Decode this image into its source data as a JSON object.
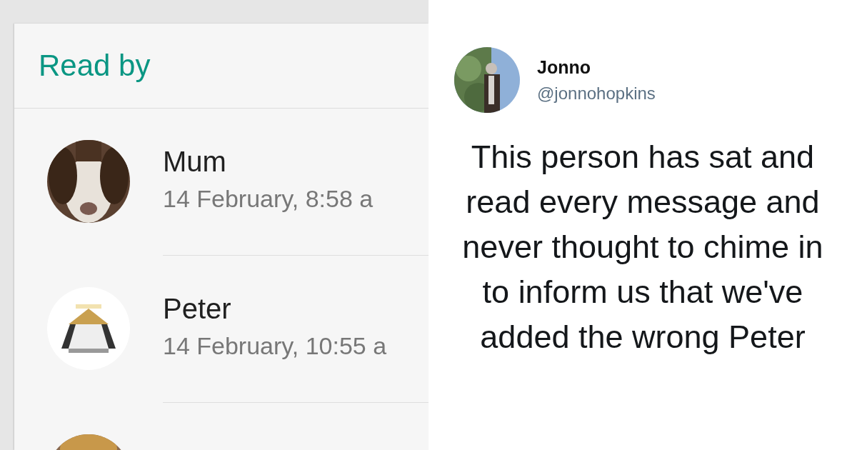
{
  "read_receipts": {
    "title": "Read by",
    "contacts": [
      {
        "name": "Mum",
        "time": "14 February, 8:58 a",
        "avatar": {
          "kind": "picture"
        }
      },
      {
        "name": "Peter",
        "time": "14 February, 10:55 a",
        "avatar": {
          "kind": "picture"
        }
      },
      {
        "avatar": {
          "kind": "picture"
        }
      }
    ]
  },
  "tweet": {
    "author": {
      "name": "Jonno",
      "handle": "@jonnohopkins"
    },
    "text": "This person has sat and read every message and never thought to chime in to inform us that we've added the wrong Peter"
  }
}
